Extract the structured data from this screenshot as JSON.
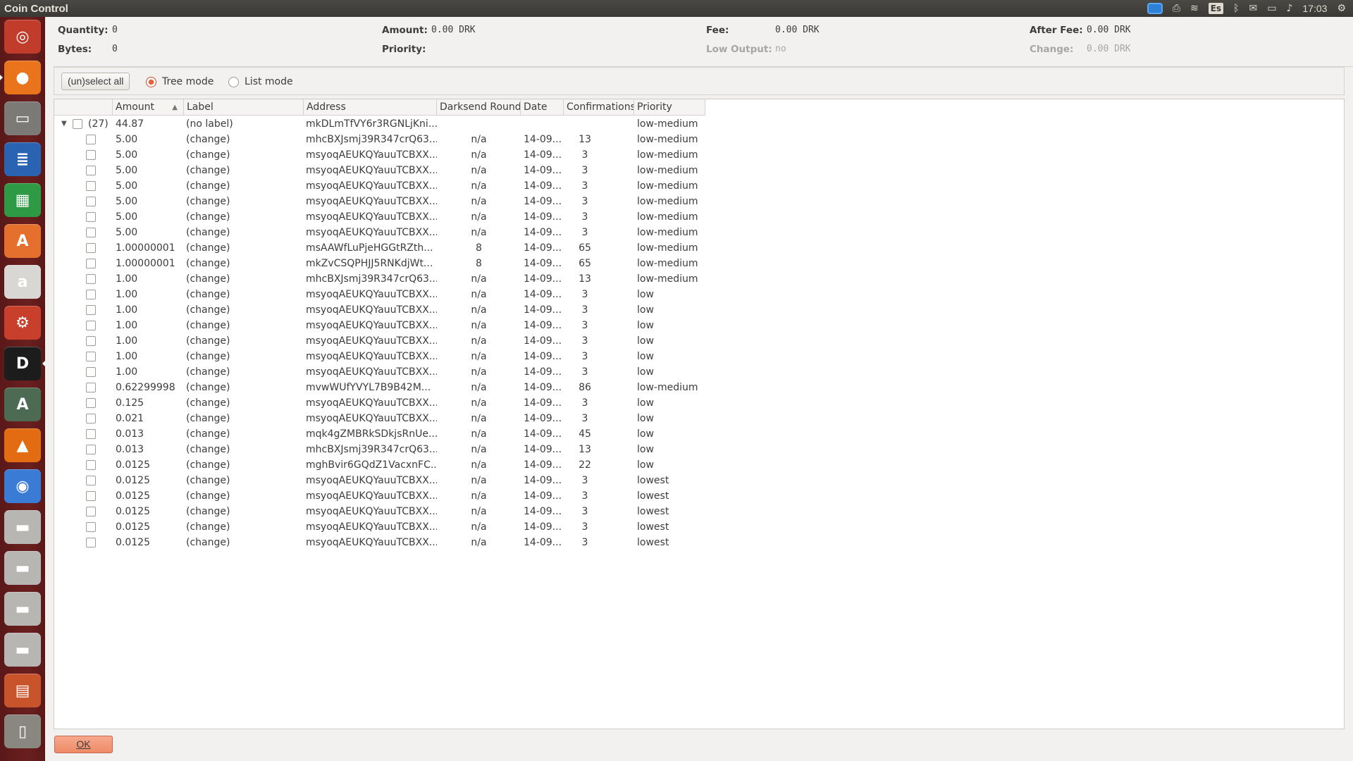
{
  "window": {
    "title": "Coin Control"
  },
  "tray": {
    "keyboard": "Es",
    "time": "17:03"
  },
  "summary": {
    "quantity_label": "Quantity:",
    "quantity_value": "0",
    "bytes_label": "Bytes:",
    "bytes_value": "0",
    "amount_label": "Amount:",
    "amount_value": "0.00 DRK",
    "priority_label": "Priority:",
    "priority_value": "",
    "fee_label": "Fee:",
    "fee_value": "0.00 DRK",
    "low_output_label": "Low Output:",
    "low_output_value": "no",
    "after_fee_label": "After Fee:",
    "after_fee_value": "0.00 DRK",
    "change_label": "Change:",
    "change_value": "0.00 DRK"
  },
  "modebar": {
    "select_all": "(un)select all",
    "tree_mode": "Tree mode",
    "list_mode": "List mode",
    "selected_mode": "tree"
  },
  "columns": [
    "Amount",
    "Label",
    "Address",
    "Darksend Rounds",
    "Date",
    "Confirmations",
    "Priority"
  ],
  "group": {
    "count": "(27)",
    "amount": "44.87",
    "label": "(no label)",
    "address": "mkDLmTfVY6r3RGNLjKni...",
    "priority": "low-medium"
  },
  "rows": [
    [
      "5.00",
      "(change)",
      "mhcBXJsmj39R347crQ63...",
      "n/a",
      "14-09...",
      "13",
      "low-medium"
    ],
    [
      "5.00",
      "(change)",
      "msyoqAEUKQYauuTCBXX...",
      "n/a",
      "14-09...",
      "3",
      "low-medium"
    ],
    [
      "5.00",
      "(change)",
      "msyoqAEUKQYauuTCBXX...",
      "n/a",
      "14-09...",
      "3",
      "low-medium"
    ],
    [
      "5.00",
      "(change)",
      "msyoqAEUKQYauuTCBXX...",
      "n/a",
      "14-09...",
      "3",
      "low-medium"
    ],
    [
      "5.00",
      "(change)",
      "msyoqAEUKQYauuTCBXX...",
      "n/a",
      "14-09...",
      "3",
      "low-medium"
    ],
    [
      "5.00",
      "(change)",
      "msyoqAEUKQYauuTCBXX...",
      "n/a",
      "14-09...",
      "3",
      "low-medium"
    ],
    [
      "5.00",
      "(change)",
      "msyoqAEUKQYauuTCBXX...",
      "n/a",
      "14-09...",
      "3",
      "low-medium"
    ],
    [
      "1.00000001",
      "(change)",
      "msAAWfLuPjeHGGtRZth...",
      "8",
      "14-09...",
      "65",
      "low-medium"
    ],
    [
      "1.00000001",
      "(change)",
      "mkZvCSQPHJJ5RNKdjWt...",
      "8",
      "14-09...",
      "65",
      "low-medium"
    ],
    [
      "1.00",
      "(change)",
      "mhcBXJsmj39R347crQ63...",
      "n/a",
      "14-09...",
      "13",
      "low-medium"
    ],
    [
      "1.00",
      "(change)",
      "msyoqAEUKQYauuTCBXX...",
      "n/a",
      "14-09...",
      "3",
      "low"
    ],
    [
      "1.00",
      "(change)",
      "msyoqAEUKQYauuTCBXX...",
      "n/a",
      "14-09...",
      "3",
      "low"
    ],
    [
      "1.00",
      "(change)",
      "msyoqAEUKQYauuTCBXX...",
      "n/a",
      "14-09...",
      "3",
      "low"
    ],
    [
      "1.00",
      "(change)",
      "msyoqAEUKQYauuTCBXX...",
      "n/a",
      "14-09...",
      "3",
      "low"
    ],
    [
      "1.00",
      "(change)",
      "msyoqAEUKQYauuTCBXX...",
      "n/a",
      "14-09...",
      "3",
      "low"
    ],
    [
      "1.00",
      "(change)",
      "msyoqAEUKQYauuTCBXX...",
      "n/a",
      "14-09...",
      "3",
      "low"
    ],
    [
      "0.62299998",
      "(change)",
      "mvwWUfYVYL7B9B42M...",
      "n/a",
      "14-09...",
      "86",
      "low-medium"
    ],
    [
      "0.125",
      "(change)",
      "msyoqAEUKQYauuTCBXX...",
      "n/a",
      "14-09...",
      "3",
      "low"
    ],
    [
      "0.021",
      "(change)",
      "msyoqAEUKQYauuTCBXX...",
      "n/a",
      "14-09...",
      "3",
      "low"
    ],
    [
      "0.013",
      "(change)",
      "mqk4gZMBRkSDkjsRnUe...",
      "n/a",
      "14-09...",
      "45",
      "low"
    ],
    [
      "0.013",
      "(change)",
      "mhcBXJsmj39R347crQ63...",
      "n/a",
      "14-09...",
      "13",
      "low"
    ],
    [
      "0.0125",
      "(change)",
      "mghBvir6GQdZ1VacxnFC...",
      "n/a",
      "14-09...",
      "22",
      "low"
    ],
    [
      "0.0125",
      "(change)",
      "msyoqAEUKQYauuTCBXX...",
      "n/a",
      "14-09...",
      "3",
      "lowest"
    ],
    [
      "0.0125",
      "(change)",
      "msyoqAEUKQYauuTCBXX...",
      "n/a",
      "14-09...",
      "3",
      "lowest"
    ],
    [
      "0.0125",
      "(change)",
      "msyoqAEUKQYauuTCBXX...",
      "n/a",
      "14-09...",
      "3",
      "lowest"
    ],
    [
      "0.0125",
      "(change)",
      "msyoqAEUKQYauuTCBXX...",
      "n/a",
      "14-09...",
      "3",
      "lowest"
    ],
    [
      "0.0125",
      "(change)",
      "msyoqAEUKQYauuTCBXX...",
      "n/a",
      "14-09...",
      "3",
      "lowest"
    ]
  ],
  "ok_label": "OK",
  "launcher": [
    {
      "name": "ubuntu-dash-icon",
      "glyph": "◎",
      "bg": "#c13c2a"
    },
    {
      "name": "firefox-icon",
      "glyph": "●",
      "bg": "#e9741b"
    },
    {
      "name": "files-icon",
      "glyph": "▭",
      "bg": "#7b7a76"
    },
    {
      "name": "writer-icon",
      "glyph": "≣",
      "bg": "#2a63b2"
    },
    {
      "name": "calc-icon",
      "glyph": "▦",
      "bg": "#2f9a45"
    },
    {
      "name": "software-center-icon",
      "glyph": "A",
      "bg": "#e5702e"
    },
    {
      "name": "amazon-icon",
      "glyph": "a",
      "bg": "#d9d7d3"
    },
    {
      "name": "system-settings-icon",
      "glyph": "⚙",
      "bg": "#c83f2c"
    },
    {
      "name": "darkcoin-wallet-icon",
      "glyph": "D",
      "bg": "#1c1c1c"
    },
    {
      "name": "software-updater-icon",
      "glyph": "A",
      "bg": "#4d6a53"
    },
    {
      "name": "vlc-icon",
      "glyph": "▲",
      "bg": "#e36c12"
    },
    {
      "name": "chromium-icon",
      "glyph": "◉",
      "bg": "#3a7bd5"
    },
    {
      "name": "drive-icon",
      "glyph": "▬",
      "bg": "#b8b6b2"
    },
    {
      "name": "drive-icon",
      "glyph": "▬",
      "bg": "#b8b6b2"
    },
    {
      "name": "drive-icon",
      "glyph": "▬",
      "bg": "#b8b6b2"
    },
    {
      "name": "drive-icon",
      "glyph": "▬",
      "bg": "#b8b6b2"
    },
    {
      "name": "impress-icon",
      "glyph": "▤",
      "bg": "#c8542c"
    },
    {
      "name": "trash-icon",
      "glyph": "▯",
      "bg": "#8a8680"
    }
  ]
}
